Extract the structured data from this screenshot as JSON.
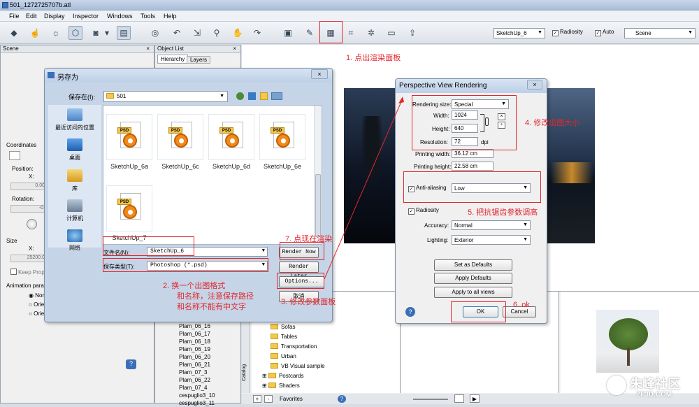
{
  "window": {
    "title": "501_1272725707b.atl"
  },
  "menu": [
    "File",
    "Edit",
    "Display",
    "Inspector",
    "Windows",
    "Tools",
    "Help"
  ],
  "toolbar": {
    "camera_select": "SketchUp_6",
    "radiosity_label": "Radiosity",
    "auto_label": "Auto",
    "scene_select": "Scene"
  },
  "scene_panel": {
    "title": "Scene",
    "coordinates": "Coordinates",
    "position": "Position:",
    "x_label": "X:",
    "pos_x": "0.00",
    "rotation": "Rotation:",
    "rot_x": "-0.",
    "size": "Size",
    "size_x_label": "X:",
    "size_x": "25200.0",
    "keep_prop": "Keep Propo",
    "animation": "Animation paran",
    "radios": [
      "Norr",
      "Orie",
      "Orie"
    ]
  },
  "object_list": {
    "title": "Object List",
    "tabs": [
      "Hierarchy",
      "Layers"
    ],
    "items": [
      "Plam_06_16",
      "Plam_06_17",
      "Plam_06_18",
      "Plam_06_19",
      "Plam_06_20",
      "Plam_06_21",
      "Plam_07_3",
      "Plam_06_22",
      "Plam_07_4",
      "cespuglio3_10",
      "cespuglio3_11"
    ]
  },
  "save_dialog": {
    "title": "另存为",
    "save_in_label": "保存在(I):",
    "save_in_value": "501",
    "places": [
      "最近访问的位置",
      "桌面",
      "库",
      "计算机",
      "网络"
    ],
    "files": [
      "SketchUp_6a",
      "SketchUp_6c",
      "SketchUp_6d",
      "SketchUp_6e",
      "SketchUp_7"
    ],
    "psd_tag": "PSD",
    "filename_label": "文件名(N):",
    "filename_value": "SketchUp_6",
    "filetype_label": "保存类型(T):",
    "filetype_value": "Photoshop (*.psd)",
    "render_now": "Render Now",
    "render_later": "Render Later",
    "options": "Options...",
    "cancel": "取消"
  },
  "render_dialog": {
    "title": "Perspective View Rendering",
    "rendering_size_label": "Rendering size:",
    "rendering_size_value": "Special",
    "width_label": "Width:",
    "width_value": "1024",
    "height_label": "Height:",
    "height_value": "640",
    "resolution_label": "Resolution:",
    "resolution_value": "72",
    "dpi": "dpi",
    "printing_width_label": "Printing width:",
    "printing_width_value": "36.12 cm",
    "printing_height_label": "Printing height:",
    "printing_height_value": "22.58 cm",
    "antialiasing_label": "Anti-aliasing",
    "antialiasing_value": "Low",
    "radiosity_label": "Radiosity",
    "accuracy_label": "Accuracy:",
    "accuracy_value": "Normal",
    "lighting_label": "Lighting:",
    "lighting_value": "Exterior",
    "set_defaults": "Set as Defaults",
    "apply_defaults": "Apply Defaults",
    "apply_all": "Apply to all views",
    "ok": "OK",
    "cancel": "Cancel"
  },
  "catalog": {
    "label": "Catalog",
    "items": [
      "Sofas",
      "Tables",
      "Transportation",
      "Urban",
      "VB Visual sample",
      "Postcards",
      "Shaders"
    ],
    "favorites": "Favorites"
  },
  "annotations": {
    "a1": "1. 点出渲染面板",
    "a2_line1": "2. 换一个出图格式",
    "a2_line2": "和名称，注意保存路径",
    "a2_line3": "和名称不能有中文字",
    "a3": "3. 修改参数面板",
    "a4": "4. 修改出图大小",
    "a5": "5. 把抗锯齿参数调高",
    "a6": "6. ok",
    "a7": "7. 点现在渲染"
  },
  "watermark": {
    "text": "朱峰社区",
    "sub": "ZF3D.COM"
  },
  "colors": {
    "annotation": "#e3262e",
    "folder": "#f2c94c",
    "psd_orange": "#f08a1c"
  }
}
